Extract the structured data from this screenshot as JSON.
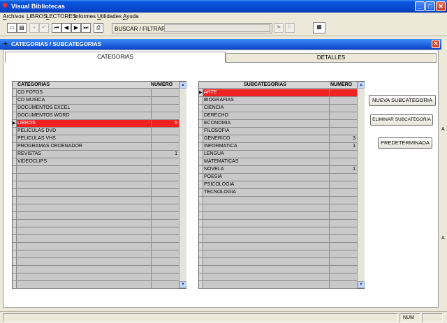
{
  "window": {
    "title": "Visual Bibliotecas"
  },
  "menu": [
    "Archivos",
    "LIBROS",
    "LECTORES",
    "Informes",
    "Utilidades",
    "Ayuda"
  ],
  "toolbar": {
    "search_label": "BUSCAR / FILTRAR:",
    "search_value": ""
  },
  "child": {
    "title": "CATEGORIAS / SUBCATEGORIAS"
  },
  "tabs": {
    "active": "CATEGORIAS",
    "inactive": "DETALLES"
  },
  "categories": {
    "col1": "CATEGORIAS",
    "col2": "NUMERO",
    "rows": [
      {
        "name": "CD FOTOS",
        "num": ""
      },
      {
        "name": "CD MUSICA",
        "num": ""
      },
      {
        "name": "DOCUMENTOS EXCEL",
        "num": ""
      },
      {
        "name": "DOCUMENTOS WORD",
        "num": ""
      },
      {
        "name": "LIBROS",
        "num": "5"
      },
      {
        "name": "PELICULAS DVD",
        "num": ""
      },
      {
        "name": "PELICULAS VHS",
        "num": ""
      },
      {
        "name": "PROGRAMAS ORDENADOR",
        "num": ""
      },
      {
        "name": "REVISTAS",
        "num": "1"
      },
      {
        "name": "VIDEOCLIPS",
        "num": ""
      }
    ],
    "selected_index": 4
  },
  "subcategories": {
    "col1": "SUBCATEGORIAS",
    "col2": "NUMERO",
    "rows": [
      {
        "name": "ARTE",
        "num": ""
      },
      {
        "name": "BIOGRAFIAS",
        "num": ""
      },
      {
        "name": "CIENCIA",
        "num": ""
      },
      {
        "name": "DERECHO",
        "num": ""
      },
      {
        "name": "ECONOMIA",
        "num": ""
      },
      {
        "name": "FILOSOFIA",
        "num": ""
      },
      {
        "name": "GENERICO",
        "num": "3"
      },
      {
        "name": "INFORMATICA",
        "num": "1"
      },
      {
        "name": "LENGUA",
        "num": ""
      },
      {
        "name": "MATEMATICAS",
        "num": ""
      },
      {
        "name": "NOVELA",
        "num": "1"
      },
      {
        "name": "POESIA",
        "num": ""
      },
      {
        "name": "PSICOLOGIA",
        "num": ""
      },
      {
        "name": "TECNOLOGIA",
        "num": ""
      }
    ],
    "selected_index": 0
  },
  "buttons": {
    "new_sub": "NUEVA SUBCATEGORIA",
    "delete_sub": "ELIMINAR SUBCATEGORIA",
    "default": "PREDETERMINADA"
  },
  "status": {
    "num": "NUM"
  },
  "colors": {
    "selected_row": "#f02121",
    "title_blue": "#0845c8"
  }
}
